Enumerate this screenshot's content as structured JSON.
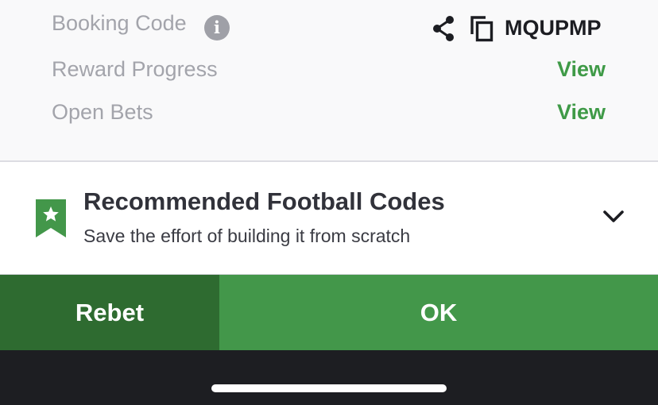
{
  "info": {
    "booking_code_label": "Booking Code",
    "info_glyph": "i",
    "booking_code_value": "MQUPMP",
    "reward_progress_label": "Reward Progress",
    "reward_progress_link": "View",
    "open_bets_label": "Open Bets",
    "open_bets_link": "View"
  },
  "recommended": {
    "title": "Recommended Football Codes",
    "subtitle": "Save the effort of building it from scratch",
    "icon": "bookmark-star-icon",
    "toggle_icon": "chevron-down-icon"
  },
  "actions": {
    "rebet_label": "Rebet",
    "ok_label": "OK"
  },
  "icons": {
    "share": "share-icon",
    "copy": "copy-icon",
    "info": "info-icon"
  },
  "colors": {
    "accent_green": "#43974a",
    "dark_green": "#2e6b30",
    "link_green": "#3f9a47",
    "label_gray": "#a3a4ab",
    "bottom_bar": "#1d1e22"
  }
}
